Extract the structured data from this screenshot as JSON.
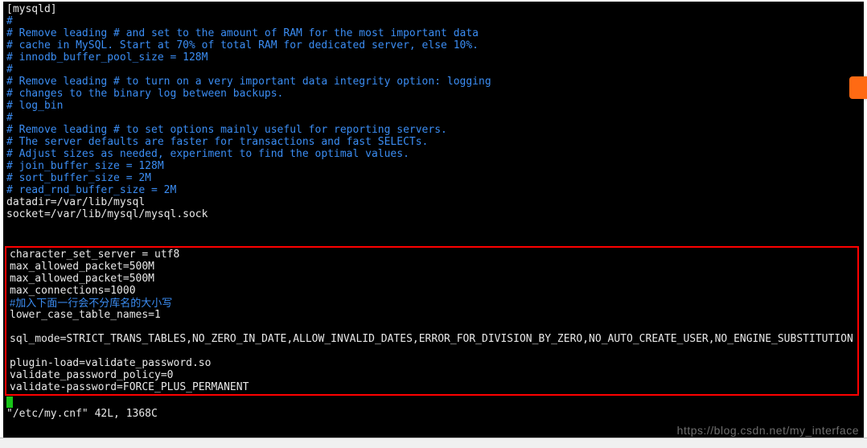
{
  "section": "[mysqld]",
  "comments_block1": [
    "#",
    "# Remove leading # and set to the amount of RAM for the most important data",
    "# cache in MySQL. Start at 70% of total RAM for dedicated server, else 10%.",
    "# innodb_buffer_pool_size = 128M",
    "#",
    "# Remove leading # to turn on a very important data integrity option: logging",
    "# changes to the binary log between backups.",
    "# log_bin",
    "#",
    "# Remove leading # to set options mainly useful for reporting servers.",
    "# The server defaults are faster for transactions and fast SELECTs.",
    "# Adjust sizes as needed, experiment to find the optimal values.",
    "# join_buffer_size = 128M",
    "# sort_buffer_size = 2M",
    "# read_rnd_buffer_size = 2M"
  ],
  "settings_before_box": [
    "datadir=/var/lib/mysql",
    "socket=/var/lib/mysql/mysql.sock"
  ],
  "boxed": {
    "lines_top": [
      "character_set_server = utf8",
      "max_allowed_packet=500M",
      "max_allowed_packet=500M",
      "max_connections=1000"
    ],
    "comment_cn": "#加入下面一行会不分库名的大小写",
    "lines_mid": [
      "lower_case_table_names=1"
    ],
    "sql_mode": "sql_mode=STRICT_TRANS_TABLES,NO_ZERO_IN_DATE,ALLOW_INVALID_DATES,ERROR_FOR_DIVISION_BY_ZERO,NO_AUTO_CREATE_USER,NO_ENGINE_SUBSTITUTION",
    "lines_bottom": [
      "plugin-load=validate_password.so",
      "validate_password_policy=0",
      "validate-password=FORCE_PLUS_PERMANENT"
    ]
  },
  "status_line": "\"/etc/my.cnf\" 42L, 1368C",
  "watermark": "https://blog.csdn.net/my_interface",
  "footer_prompt": ""
}
